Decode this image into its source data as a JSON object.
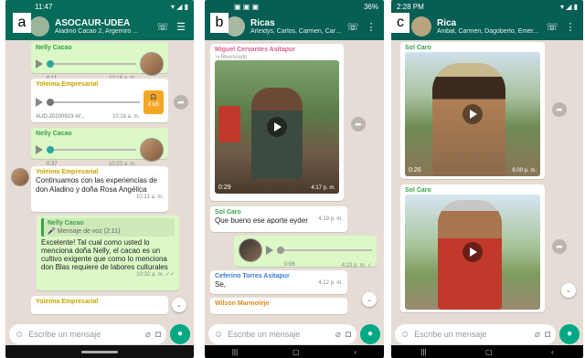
{
  "colors": {
    "header_a": "#076b5a",
    "header_b": "#075e54",
    "accent": "#00a884",
    "bubble_out": "#dcf8c6"
  },
  "panel_a": {
    "label": "a",
    "status_time": "11:47",
    "title": "ASOCAUR-UDEA",
    "subtitle": "Aladino Cacao 2, Argemiro ...",
    "voice1": {
      "sender": "Nelly Cacao",
      "duration": "0:11",
      "time": "10:16 a. m."
    },
    "audio": {
      "sender": "Yoleima Empresarial",
      "filename": "AUD-20200923-W...",
      "size": "8 kB",
      "time": "10:16 a. m."
    },
    "voice2": {
      "sender": "Nelly Cacao",
      "duration": "0:37",
      "time": "10:23 a. m."
    },
    "text1": {
      "sender": "Yoleima Empresarial",
      "text": "Continuamos con las experiencias de don Aladino y doña Rosa Angélica",
      "time": "10:31 a. m."
    },
    "reply": {
      "quote_sender": "Nelly Cacao",
      "quote_text": "🎤 Mensaje de voz (2:11)",
      "text": "Excelente! Tal cual como usted lo menciona doña Nelly, el cacao es un cultivo exigente que como lo menciona don Blas requiere de labores culturales",
      "time": "10:32 a. m. ✓✓"
    },
    "last_sender": "Yoleima Empresarial",
    "input_placeholder": "Escribe un mensaje"
  },
  "panel_b": {
    "label": "b",
    "battery": "36%",
    "title": "Ricas",
    "subtitle": "Arleidys, Carlos, Carmen, Carmen...",
    "video": {
      "sender": "Miguel Cervantes Asitapur",
      "forwarded": "↪ Reenviado",
      "duration": "0:29",
      "time": "4:17 p. m."
    },
    "text1": {
      "sender": "Sol Caro",
      "text": "Que bueno ese aporte eyder",
      "time": "4:19 p. m."
    },
    "voice": {
      "duration": "0:06",
      "time": "4:23 p. m. ✓"
    },
    "text2": {
      "sender": "Ceferino Torres Asitapur",
      "text": "Se,",
      "time": "4:12 p. m."
    },
    "last_sender": "Wilson Marmoleje",
    "input_placeholder": "Escribe un mensaje"
  },
  "panel_c": {
    "label": "c",
    "status_time": "2:28 PM",
    "title": "Rica",
    "subtitle": "Anibal, Carmen, Dagoberto, Emér...",
    "video1": {
      "sender": "Sol Caro",
      "duration": "0:26",
      "time": "6:00 p. m."
    },
    "video2": {
      "sender": "Sol Caro"
    },
    "input_placeholder": "Escribe un mensaje"
  }
}
